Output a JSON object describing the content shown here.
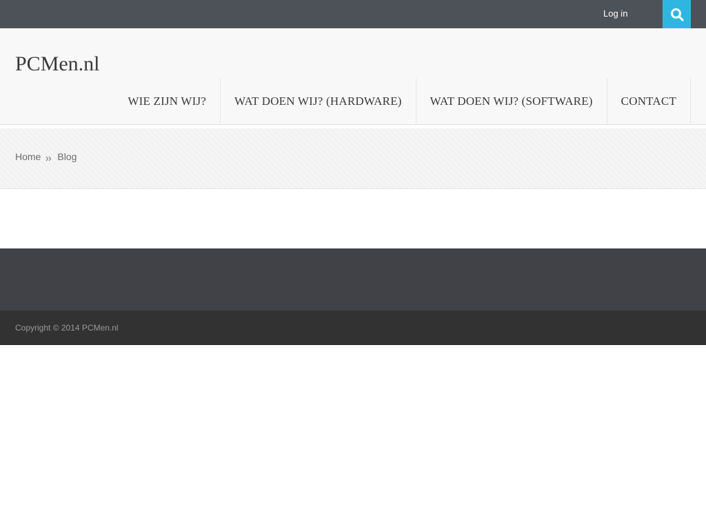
{
  "topbar": {
    "login_label": "Log in",
    "search_icon": "search-icon",
    "colors": {
      "bar": "#4d5258",
      "search_button": "#2fb6e0"
    }
  },
  "header": {
    "logo": "PCMen.nl",
    "nav": [
      {
        "label": "WIE ZIJN WIJ?"
      },
      {
        "label": "WAT DOEN WIJ? (HARDWARE)"
      },
      {
        "label": "WAT DOEN WIJ? (SOFTWARE)"
      },
      {
        "label": "CONTACT"
      }
    ]
  },
  "breadcrumb": {
    "home": "Home",
    "separator_icon": "double-chevron-icon",
    "current": "Blog"
  },
  "footer": {
    "copyright": "Copyright © 2014 PCMen.nl",
    "colors": {
      "widgets": "#414247",
      "bottom": "#323232"
    }
  }
}
